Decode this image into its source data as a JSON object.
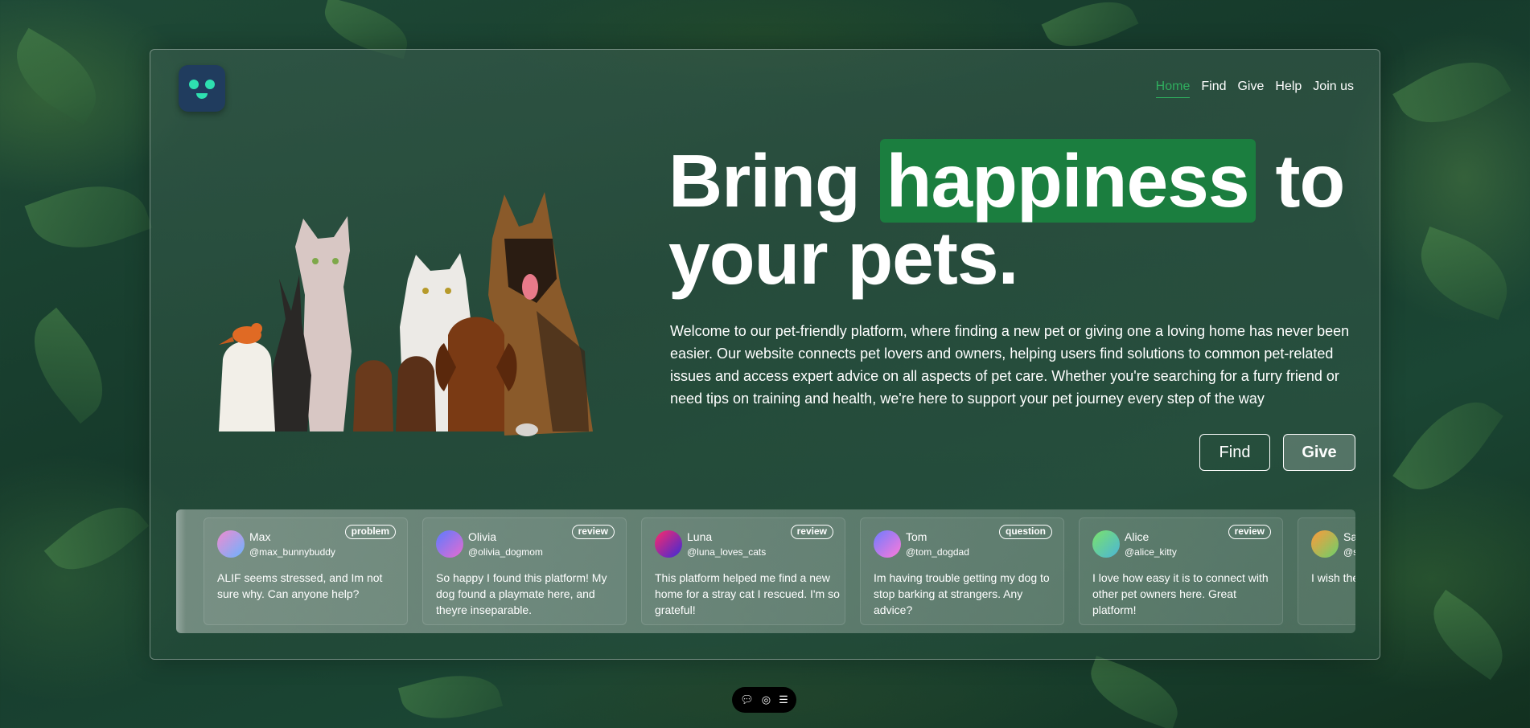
{
  "nav": {
    "items": [
      {
        "label": "Home",
        "active": true
      },
      {
        "label": "Find",
        "active": false
      },
      {
        "label": "Give",
        "active": false
      },
      {
        "label": "Help",
        "active": false
      },
      {
        "label": "Join us",
        "active": false
      }
    ]
  },
  "hero": {
    "title_part1": "Bring",
    "title_highlight": "happiness",
    "title_part2": "to your pets.",
    "description": "Welcome to our pet-friendly platform, where finding a new pet or giving one a loving home has never been easier. Our website connects pet lovers and owners, helping users find solutions to common pet-related issues and access expert advice on all aspects of pet care. Whether you're searching for a furry friend or need tips on training and health, we're here to support your pet journey every step of the way",
    "find_label": "Find",
    "give_label": "Give"
  },
  "posts": [
    {
      "name": "Max",
      "handle": "@max_bunnybuddy",
      "tag": "problem",
      "text": "ALIF seems stressed, and Im not sure why. Can anyone help?",
      "avatar_colors": [
        "#f08bd0",
        "#6bb3ff"
      ]
    },
    {
      "name": "Olivia",
      "handle": "@olivia_dogmom",
      "tag": "review",
      "text": "So happy I found this platform! My dog found a playmate here, and theyre inseparable.",
      "avatar_colors": [
        "#5b7bff",
        "#e86bd0"
      ]
    },
    {
      "name": "Luna",
      "handle": "@luna_loves_cats",
      "tag": "review",
      "text": "This platform helped me find a new home for a stray cat I rescued. I'm so grateful!",
      "avatar_colors": [
        "#ff2a6a",
        "#3a2bd8"
      ]
    },
    {
      "name": "Tom",
      "handle": "@tom_dogdad",
      "tag": "question",
      "text": "Im having trouble getting my dog to stop barking at strangers. Any advice?",
      "avatar_colors": [
        "#6e7bff",
        "#ff7ad9"
      ]
    },
    {
      "name": "Alice",
      "handle": "@alice_kitty",
      "tag": "review",
      "text": "I love how easy it is to connect with other pet owners here. Great platform!",
      "avatar_colors": [
        "#7be26b",
        "#4bb5d8"
      ]
    },
    {
      "name": "Sa",
      "handle": "@s",
      "tag": "",
      "text": "I wish the to keep p suggesti",
      "avatar_colors": [
        "#ff9a3a",
        "#6bd06b"
      ]
    }
  ],
  "toolbar": {
    "icons": [
      "chat-icon",
      "eye-icon",
      "menu-icon"
    ]
  },
  "colors": {
    "accent": "#1b7e3f",
    "nav_active": "#2fae5e",
    "logo_bg": "#203c5e",
    "logo_face": "#2ee0b0"
  }
}
